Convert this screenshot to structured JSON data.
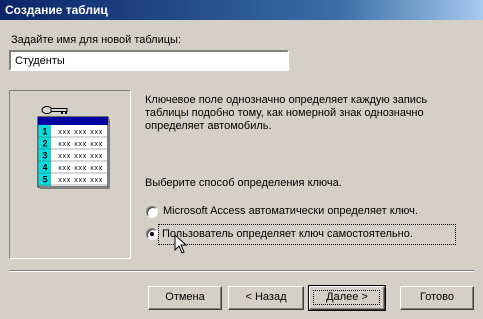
{
  "window": {
    "title": "Создание таблиц"
  },
  "form": {
    "name_prompt": "Задайте имя для новой таблицы:",
    "table_name": "Студенты"
  },
  "illustration": {
    "row_numbers": [
      "1",
      "2",
      "3",
      "4",
      "5"
    ],
    "cell_text": "xxx",
    "header_color": "#0000a0",
    "number_color": "#00e0e0",
    "key_icon": "key-icon"
  },
  "description": "Ключевое поле однозначно определяет каждую запись таблицы подобно тому, как номерной знак однозначно определяет автомобиль.",
  "key_choice": {
    "prompt": "Выберите способ определения ключа.",
    "options": [
      {
        "label": "Microsoft Access автоматически определяет ключ.",
        "selected": false
      },
      {
        "label": "Пользователь определяет ключ самостоятельно.",
        "selected": true
      }
    ]
  },
  "buttons": {
    "cancel": "Отмена",
    "back": "< Назад",
    "next": "Далее >",
    "finish": "Готово"
  }
}
